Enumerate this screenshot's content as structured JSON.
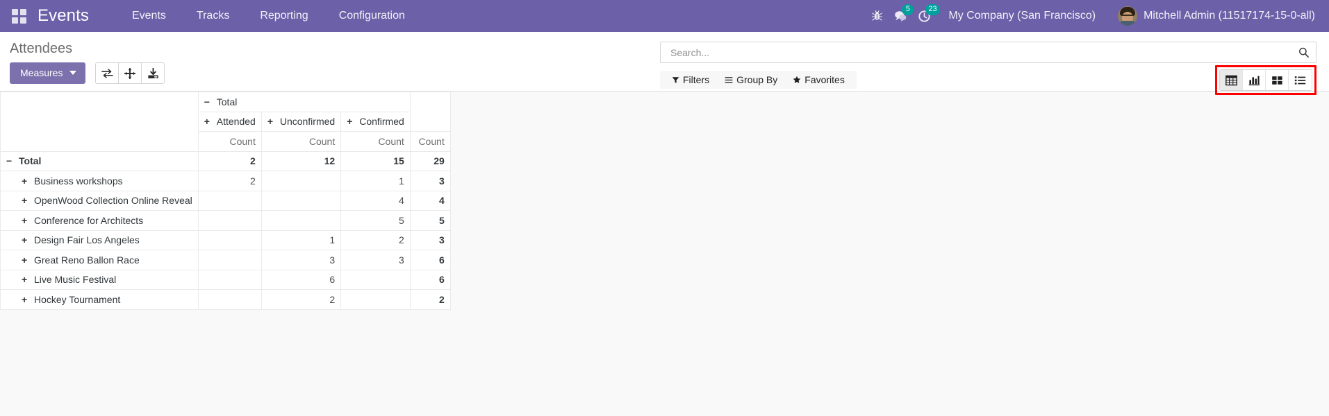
{
  "navbar": {
    "apps_icon": "apps-grid-icon",
    "brand": "Events",
    "menu_items": [
      {
        "label": "Events"
      },
      {
        "label": "Tracks"
      },
      {
        "label": "Reporting"
      },
      {
        "label": "Configuration"
      }
    ],
    "sys_icons": [
      {
        "name": "bug-icon",
        "glyph": "🐞",
        "badge": null
      },
      {
        "name": "messages-icon",
        "glyph": "💬",
        "badge": "5"
      },
      {
        "name": "activities-clock-icon",
        "glyph": "◔",
        "badge": "23"
      }
    ],
    "company": "My Company (San Francisco)",
    "user": "Mitchell Admin (11517174-15-0-all)",
    "accent_color": "#6C60A8",
    "badge_color": "#00A09D"
  },
  "control_panel": {
    "breadcrumb": "Attendees",
    "measures_label": "Measures",
    "icon_buttons": [
      {
        "name": "flip-axis-icon",
        "title": "Flip axis"
      },
      {
        "name": "expand-all-icon",
        "title": "Expand all"
      },
      {
        "name": "download-xlsx-icon",
        "title": "Download xlsx"
      }
    ],
    "search": {
      "placeholder": "Search...",
      "value": "",
      "icon": "search-icon"
    },
    "filter_menus": [
      {
        "label": "Filters",
        "icon": "filter-funnel-icon"
      },
      {
        "label": "Group By",
        "icon": "group-by-bars-icon"
      },
      {
        "label": "Favorites",
        "icon": "favorites-star-icon"
      }
    ],
    "view_switcher": {
      "highlight_color": "#FF0000",
      "buttons": [
        {
          "name": "pivot-view-icon",
          "label": "Pivot",
          "active": true
        },
        {
          "name": "graph-view-icon",
          "label": "Graph",
          "active": false
        },
        {
          "name": "kanban-view-icon",
          "label": "Kanban",
          "active": false
        },
        {
          "name": "list-view-icon",
          "label": "List",
          "active": false
        }
      ]
    }
  },
  "pivot": {
    "col_group_root": {
      "label": "Total",
      "toggle": "−"
    },
    "col_headers": [
      {
        "label": "Attended",
        "toggle": "+"
      },
      {
        "label": "Unconfirmed",
        "toggle": "+"
      },
      {
        "label": "Confirmed",
        "toggle": "+"
      }
    ],
    "measure_labels": [
      "Count",
      "Count",
      "Count",
      "Count"
    ],
    "rows": [
      {
        "label": "Total",
        "toggle": "−",
        "is_total": true,
        "values": [
          "2",
          "12",
          "15",
          "29"
        ]
      },
      {
        "label": "Business workshops",
        "toggle": "+",
        "is_total": false,
        "values": [
          "2",
          "",
          "1",
          "3"
        ]
      },
      {
        "label": "OpenWood Collection Online Reveal",
        "toggle": "+",
        "is_total": false,
        "values": [
          "",
          "",
          "4",
          "4"
        ]
      },
      {
        "label": "Conference for Architects",
        "toggle": "+",
        "is_total": false,
        "values": [
          "",
          "",
          "5",
          "5"
        ]
      },
      {
        "label": "Design Fair Los Angeles",
        "toggle": "+",
        "is_total": false,
        "values": [
          "",
          "1",
          "2",
          "3"
        ]
      },
      {
        "label": "Great Reno Ballon Race",
        "toggle": "+",
        "is_total": false,
        "values": [
          "",
          "3",
          "3",
          "6"
        ]
      },
      {
        "label": "Live Music Festival",
        "toggle": "+",
        "is_total": false,
        "values": [
          "",
          "6",
          "",
          "6"
        ]
      },
      {
        "label": "Hockey Tournament",
        "toggle": "+",
        "is_total": false,
        "values": [
          "",
          "2",
          "",
          "2"
        ]
      }
    ]
  }
}
